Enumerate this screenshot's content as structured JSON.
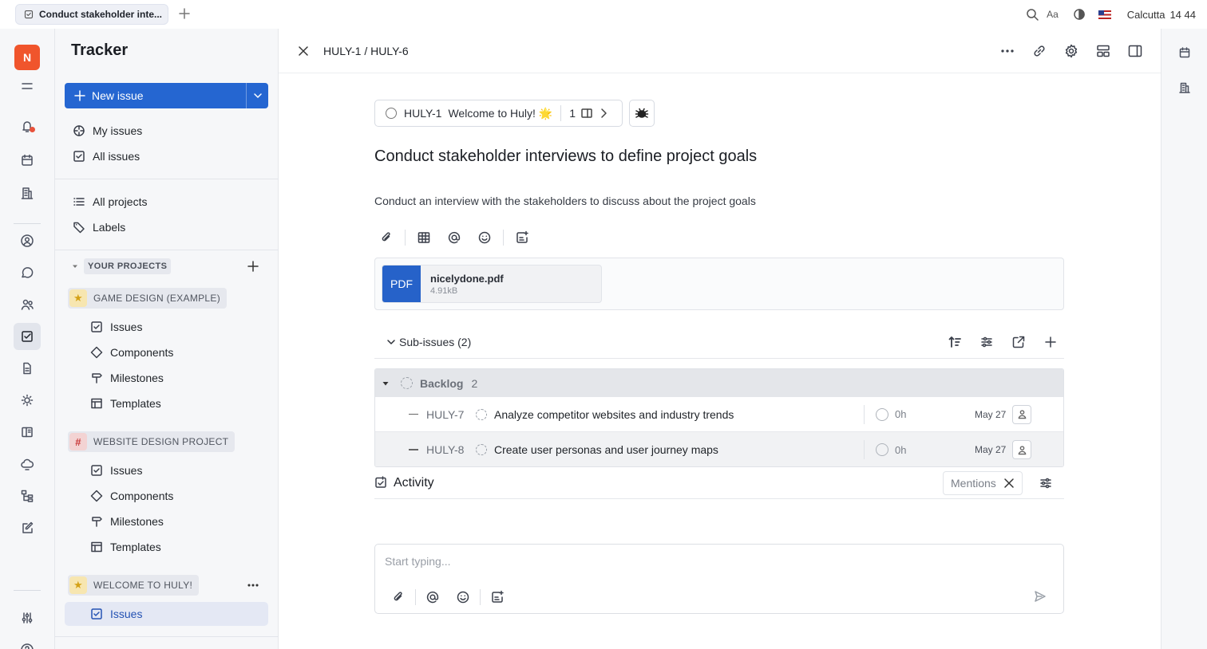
{
  "tab": {
    "title": "Conduct stakeholder inte..."
  },
  "topbar": {
    "font_size_label": "Aa",
    "timezone_label": "Calcutta",
    "time": "14 44"
  },
  "rail": {
    "workspace_initial": "N"
  },
  "sidebar": {
    "title": "Tracker",
    "new_issue_label": "New issue",
    "my_issues": "My issues",
    "all_issues": "All issues",
    "all_projects": "All projects",
    "labels": "Labels",
    "your_projects": "YOUR PROJECTS",
    "projects": [
      {
        "name": "GAME DESIGN (EXAMPLE)",
        "icon": "star",
        "items": [
          "Issues",
          "Components",
          "Milestones",
          "Templates"
        ]
      },
      {
        "name": "WEBSITE DESIGN PROJECT",
        "icon": "hash",
        "items": [
          "Issues",
          "Components",
          "Milestones",
          "Templates"
        ]
      },
      {
        "name": "WELCOME TO HULY!",
        "icon": "star",
        "items": [
          "Issues"
        ]
      }
    ]
  },
  "header": {
    "breadcrumb": "HULY-1 / HULY-6"
  },
  "issue": {
    "parent_id": "HULY-1",
    "parent_title": "Welcome to Huly! 🌟",
    "parent_subcount": "1",
    "title": "Conduct stakeholder interviews to define project goals",
    "description": "Conduct an interview with the stakeholders to discuss about the project goals",
    "attachment": {
      "type": "PDF",
      "name": "nicelydone.pdf",
      "size": "4.91kB"
    }
  },
  "subissues": {
    "label": "Sub-issues (2)",
    "group": {
      "name": "Backlog",
      "count": "2"
    },
    "rows": [
      {
        "id": "HULY-7",
        "title": "Analyze competitor websites and industry trends",
        "estimate": "0h",
        "due": "May 27"
      },
      {
        "id": "HULY-8",
        "title": "Create user personas and user journey maps",
        "estimate": "0h",
        "due": "May 27"
      }
    ]
  },
  "activity": {
    "title": "Activity",
    "filter": "Mentions"
  },
  "composer": {
    "placeholder": "Start typing..."
  },
  "colors": {
    "accent": "#2566d1",
    "workspace": "#f0552c",
    "notification": "#e8523c"
  }
}
